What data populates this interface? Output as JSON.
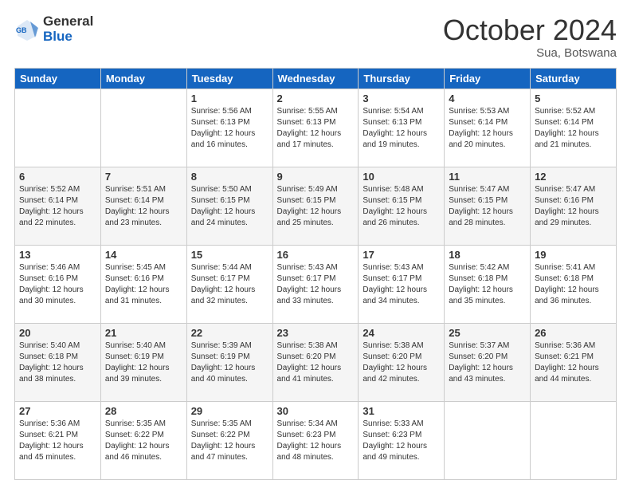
{
  "header": {
    "logo_general": "General",
    "logo_blue": "Blue",
    "month_year": "October 2024",
    "location": "Sua, Botswana"
  },
  "weekdays": [
    "Sunday",
    "Monday",
    "Tuesday",
    "Wednesday",
    "Thursday",
    "Friday",
    "Saturday"
  ],
  "weeks": [
    [
      {
        "day": "",
        "info": ""
      },
      {
        "day": "",
        "info": ""
      },
      {
        "day": "1",
        "info": "Sunrise: 5:56 AM\nSunset: 6:13 PM\nDaylight: 12 hours and 16 minutes."
      },
      {
        "day": "2",
        "info": "Sunrise: 5:55 AM\nSunset: 6:13 PM\nDaylight: 12 hours and 17 minutes."
      },
      {
        "day": "3",
        "info": "Sunrise: 5:54 AM\nSunset: 6:13 PM\nDaylight: 12 hours and 19 minutes."
      },
      {
        "day": "4",
        "info": "Sunrise: 5:53 AM\nSunset: 6:14 PM\nDaylight: 12 hours and 20 minutes."
      },
      {
        "day": "5",
        "info": "Sunrise: 5:52 AM\nSunset: 6:14 PM\nDaylight: 12 hours and 21 minutes."
      }
    ],
    [
      {
        "day": "6",
        "info": "Sunrise: 5:52 AM\nSunset: 6:14 PM\nDaylight: 12 hours and 22 minutes."
      },
      {
        "day": "7",
        "info": "Sunrise: 5:51 AM\nSunset: 6:14 PM\nDaylight: 12 hours and 23 minutes."
      },
      {
        "day": "8",
        "info": "Sunrise: 5:50 AM\nSunset: 6:15 PM\nDaylight: 12 hours and 24 minutes."
      },
      {
        "day": "9",
        "info": "Sunrise: 5:49 AM\nSunset: 6:15 PM\nDaylight: 12 hours and 25 minutes."
      },
      {
        "day": "10",
        "info": "Sunrise: 5:48 AM\nSunset: 6:15 PM\nDaylight: 12 hours and 26 minutes."
      },
      {
        "day": "11",
        "info": "Sunrise: 5:47 AM\nSunset: 6:15 PM\nDaylight: 12 hours and 28 minutes."
      },
      {
        "day": "12",
        "info": "Sunrise: 5:47 AM\nSunset: 6:16 PM\nDaylight: 12 hours and 29 minutes."
      }
    ],
    [
      {
        "day": "13",
        "info": "Sunrise: 5:46 AM\nSunset: 6:16 PM\nDaylight: 12 hours and 30 minutes."
      },
      {
        "day": "14",
        "info": "Sunrise: 5:45 AM\nSunset: 6:16 PM\nDaylight: 12 hours and 31 minutes."
      },
      {
        "day": "15",
        "info": "Sunrise: 5:44 AM\nSunset: 6:17 PM\nDaylight: 12 hours and 32 minutes."
      },
      {
        "day": "16",
        "info": "Sunrise: 5:43 AM\nSunset: 6:17 PM\nDaylight: 12 hours and 33 minutes."
      },
      {
        "day": "17",
        "info": "Sunrise: 5:43 AM\nSunset: 6:17 PM\nDaylight: 12 hours and 34 minutes."
      },
      {
        "day": "18",
        "info": "Sunrise: 5:42 AM\nSunset: 6:18 PM\nDaylight: 12 hours and 35 minutes."
      },
      {
        "day": "19",
        "info": "Sunrise: 5:41 AM\nSunset: 6:18 PM\nDaylight: 12 hours and 36 minutes."
      }
    ],
    [
      {
        "day": "20",
        "info": "Sunrise: 5:40 AM\nSunset: 6:18 PM\nDaylight: 12 hours and 38 minutes."
      },
      {
        "day": "21",
        "info": "Sunrise: 5:40 AM\nSunset: 6:19 PM\nDaylight: 12 hours and 39 minutes."
      },
      {
        "day": "22",
        "info": "Sunrise: 5:39 AM\nSunset: 6:19 PM\nDaylight: 12 hours and 40 minutes."
      },
      {
        "day": "23",
        "info": "Sunrise: 5:38 AM\nSunset: 6:20 PM\nDaylight: 12 hours and 41 minutes."
      },
      {
        "day": "24",
        "info": "Sunrise: 5:38 AM\nSunset: 6:20 PM\nDaylight: 12 hours and 42 minutes."
      },
      {
        "day": "25",
        "info": "Sunrise: 5:37 AM\nSunset: 6:20 PM\nDaylight: 12 hours and 43 minutes."
      },
      {
        "day": "26",
        "info": "Sunrise: 5:36 AM\nSunset: 6:21 PM\nDaylight: 12 hours and 44 minutes."
      }
    ],
    [
      {
        "day": "27",
        "info": "Sunrise: 5:36 AM\nSunset: 6:21 PM\nDaylight: 12 hours and 45 minutes."
      },
      {
        "day": "28",
        "info": "Sunrise: 5:35 AM\nSunset: 6:22 PM\nDaylight: 12 hours and 46 minutes."
      },
      {
        "day": "29",
        "info": "Sunrise: 5:35 AM\nSunset: 6:22 PM\nDaylight: 12 hours and 47 minutes."
      },
      {
        "day": "30",
        "info": "Sunrise: 5:34 AM\nSunset: 6:23 PM\nDaylight: 12 hours and 48 minutes."
      },
      {
        "day": "31",
        "info": "Sunrise: 5:33 AM\nSunset: 6:23 PM\nDaylight: 12 hours and 49 minutes."
      },
      {
        "day": "",
        "info": ""
      },
      {
        "day": "",
        "info": ""
      }
    ]
  ]
}
